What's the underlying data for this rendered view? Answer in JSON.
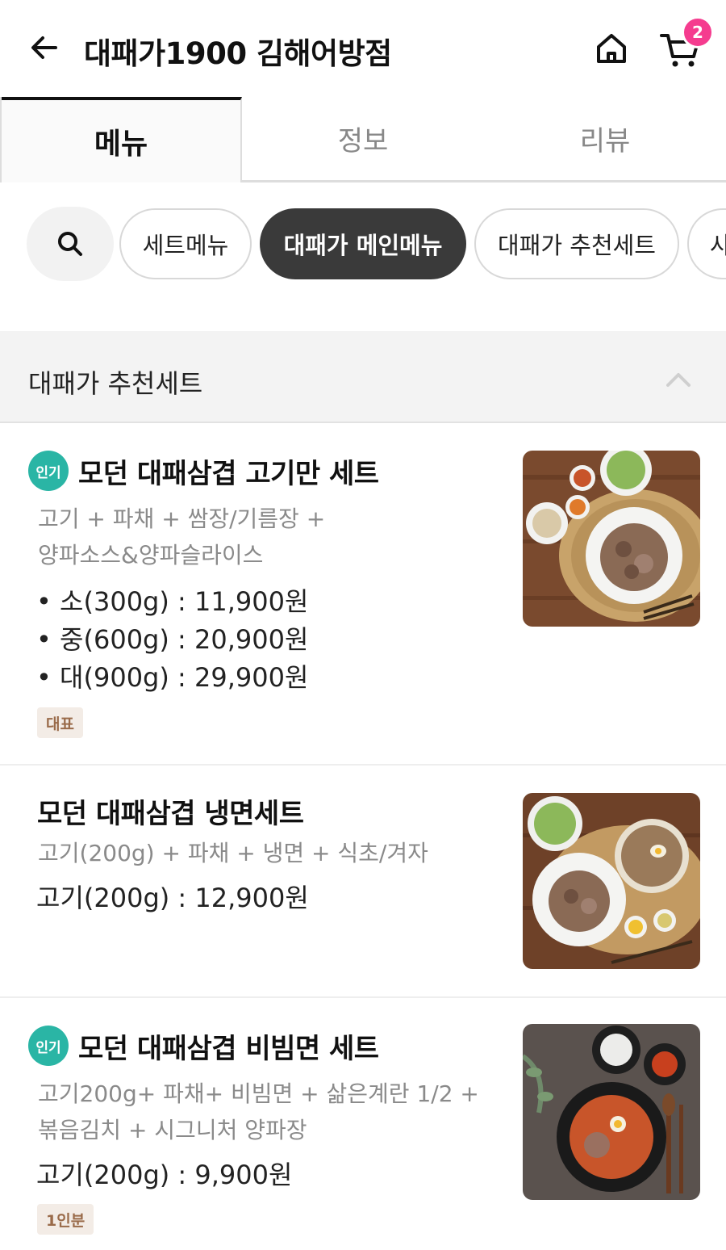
{
  "header": {
    "title": "대패가1900 김해어방점",
    "cart_count": "2"
  },
  "tabs": [
    {
      "label": "메뉴"
    },
    {
      "label": "정보"
    },
    {
      "label": "리뷰"
    }
  ],
  "chips": [
    {
      "label": "세트메뉴"
    },
    {
      "label": "대패가 메인메뉴"
    },
    {
      "label": "대패가 추천세트"
    },
    {
      "label": "사"
    }
  ],
  "section": {
    "title": "대패가 추천세트"
  },
  "items": [
    {
      "badge": "인기",
      "name": "모던 대패삼겹 고기만 세트",
      "desc": "고기 + 파채 + 쌈장/기름장 + 양파소스&양파슬라이스",
      "prices": [
        "• 소(300g) : 11,900원",
        "• 중(600g) : 20,900원",
        "• 대(900g) : 29,900원"
      ],
      "tag": "대표"
    },
    {
      "name": "모던 대패삼겹 냉면세트",
      "desc": "고기(200g) + 파채 + 냉면 + 식초/겨자",
      "prices": [
        "고기(200g) : 12,900원"
      ]
    },
    {
      "badge": "인기",
      "name": "모던 대패삼겹 비빔면 세트",
      "desc": "고기200g+ 파채+ 비빔면 + 삶은계란 1/2 + 볶음김치 + 시그니처 양파장",
      "prices": [
        "고기(200g) : 9,900원"
      ],
      "tag": "1인분"
    }
  ],
  "colors": {
    "cart_badge": "#f53c8f",
    "popular_badge": "#2ab5a5",
    "active_chip": "#3a3a3a",
    "tag_bg": "#f3ece6",
    "tag_text": "#9a6b4a"
  }
}
